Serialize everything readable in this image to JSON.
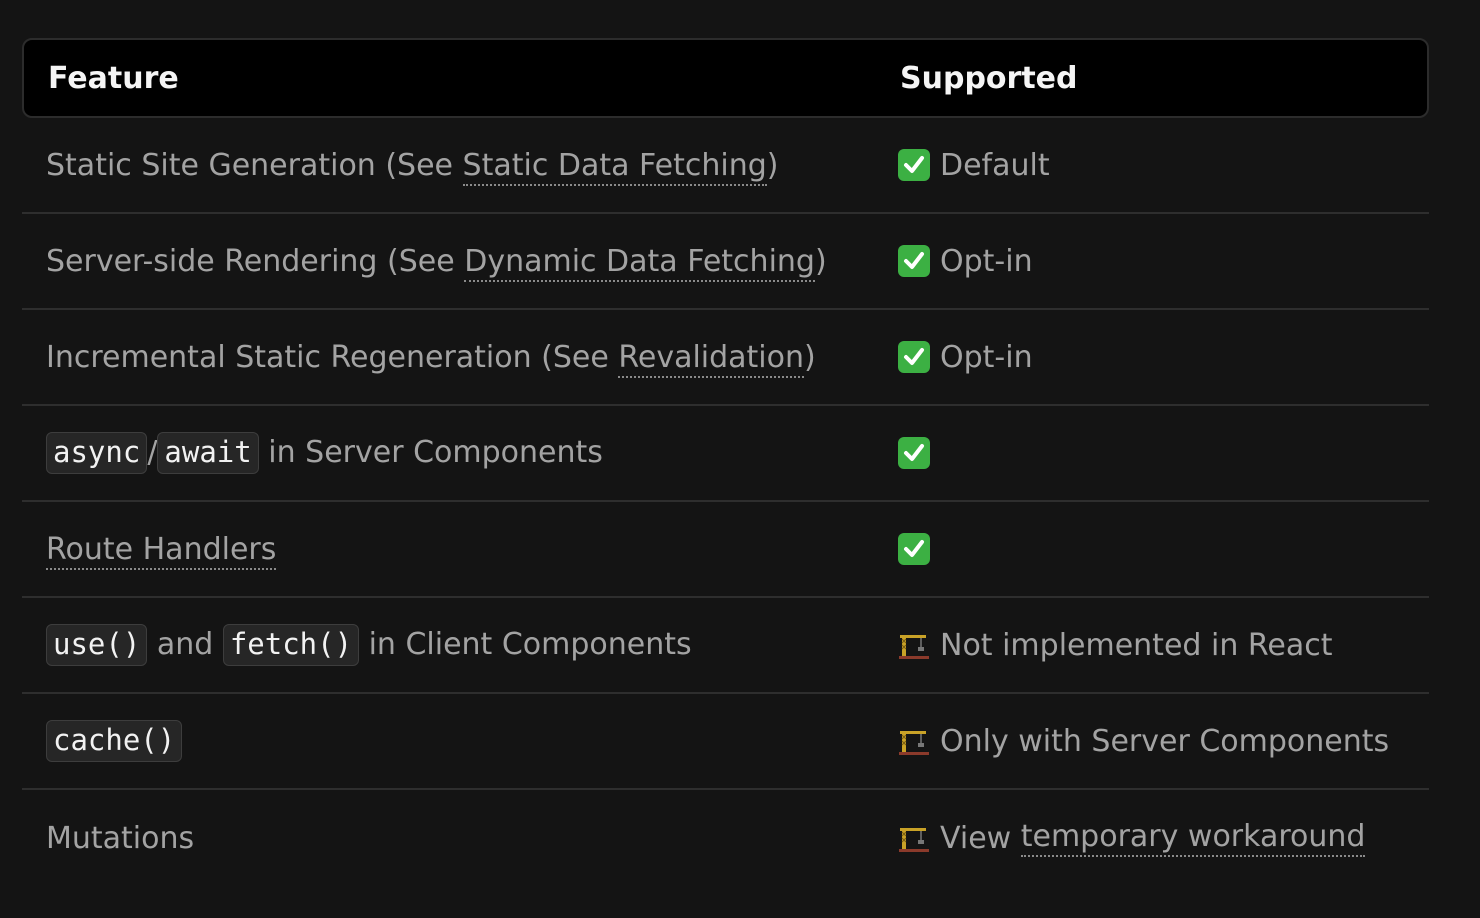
{
  "header": {
    "feature": "Feature",
    "supported": "Supported"
  },
  "rows": [
    {
      "pre": "Static Site Generation (See ",
      "link": "Static Data Fetching",
      "post": ")",
      "status_icon": "check-icon",
      "status": "Default"
    },
    {
      "pre": "Server-side Rendering (See ",
      "link": "Dynamic Data Fetching",
      "post": ")",
      "status_icon": "check-icon",
      "status": "Opt-in"
    },
    {
      "pre": "Incremental Static Regeneration (See ",
      "link": "Revalidation",
      "post": ")",
      "status_icon": "check-icon",
      "status": "Opt-in"
    },
    {
      "code1": "async",
      "sep": "/",
      "code2": "await",
      "post": " in Server Components",
      "status_icon": "check-icon",
      "status": ""
    },
    {
      "link": "Route Handlers",
      "status_icon": "check-icon",
      "status": ""
    },
    {
      "code1": "use()",
      "mid": " and ",
      "code2": "fetch()",
      "post": " in Client Components",
      "status_icon": "crane-icon",
      "status": "Not implemented in React"
    },
    {
      "code1": "cache()",
      "status_icon": "crane-icon",
      "status": "Only with Server Components"
    },
    {
      "text": "Mutations",
      "status_icon": "crane-icon",
      "status_pre": "View ",
      "status_link": "temporary workaround"
    }
  ],
  "colors": {
    "background": "#141414",
    "header_bg": "#000000",
    "check_green": "#3cb043"
  }
}
